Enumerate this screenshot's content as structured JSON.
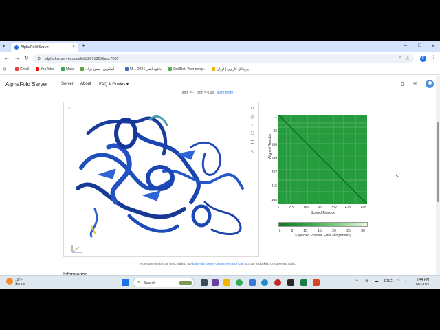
{
  "browser": {
    "tab_title": "AlphaFold Server",
    "tab_close": "×",
    "new_tab": "+",
    "url": "alphafoldserver.com/fold/26718f26fabc7087",
    "profile_initial": "E"
  },
  "bookmarks": [
    {
      "label": "Gmail",
      "color": "#ea4335"
    },
    {
      "label": "YouTube",
      "color": "#ff0000"
    },
    {
      "label": "Maps",
      "color": "#34a853"
    },
    {
      "label": "...اسکرین - بسی درا",
      "color": "#5f9e3f"
    },
    {
      "label": "Mi... دانلود آهنی 2024",
      "color": "#3d6fb6"
    },
    {
      "label": "QuillBot: Your comp...",
      "color": "#4caf50"
    },
    {
      "label": "پروفایل کاربری | اوزان",
      "color": "#f5b400"
    }
  ],
  "header": {
    "brand": "AlphaFold Server",
    "nav": [
      "Server",
      "About",
      "FAQ & Guides ▾"
    ]
  },
  "clipped_text": {
    "a": "iptm = -",
    "b": "ptm = 0.98",
    "link": "learn more"
  },
  "pae": {
    "ylabel": "Aligned Residue",
    "xlabel": "Scored Residue",
    "yticks": [
      "1",
      "83",
      "166",
      "249",
      "332",
      "415",
      "498"
    ],
    "xticks": [
      "1",
      "83",
      "166",
      "249",
      "332",
      "415",
      "498"
    ],
    "colorbar_ticks": [
      "0",
      "5",
      "10",
      "15",
      "20",
      "25",
      "30"
    ],
    "colorbar_label": "Expected Position Error (Ångströms)",
    "colors": {
      "low": "#0f7a24",
      "mid": "#37a447",
      "high": "#eef8ec"
    }
  },
  "footnote": {
    "pre": "Non-commercial use only, subject to ",
    "link": "AlphaFold Server Output Terms of Use",
    "post": "; no use in docking or screening tools."
  },
  "cut_heading": "Information",
  "taskbar": {
    "temp": "19°F",
    "condition": "Sunny",
    "search": "Search",
    "lang": "ENG",
    "time": "2:44 PM",
    "date": "8/2/2026"
  },
  "icons": {
    "viewer_tools": [
      "reset-view-icon",
      "focus-icon",
      "zoom-icon",
      "fullscreen-icon",
      "layers-icon",
      "pointer-icon"
    ]
  }
}
